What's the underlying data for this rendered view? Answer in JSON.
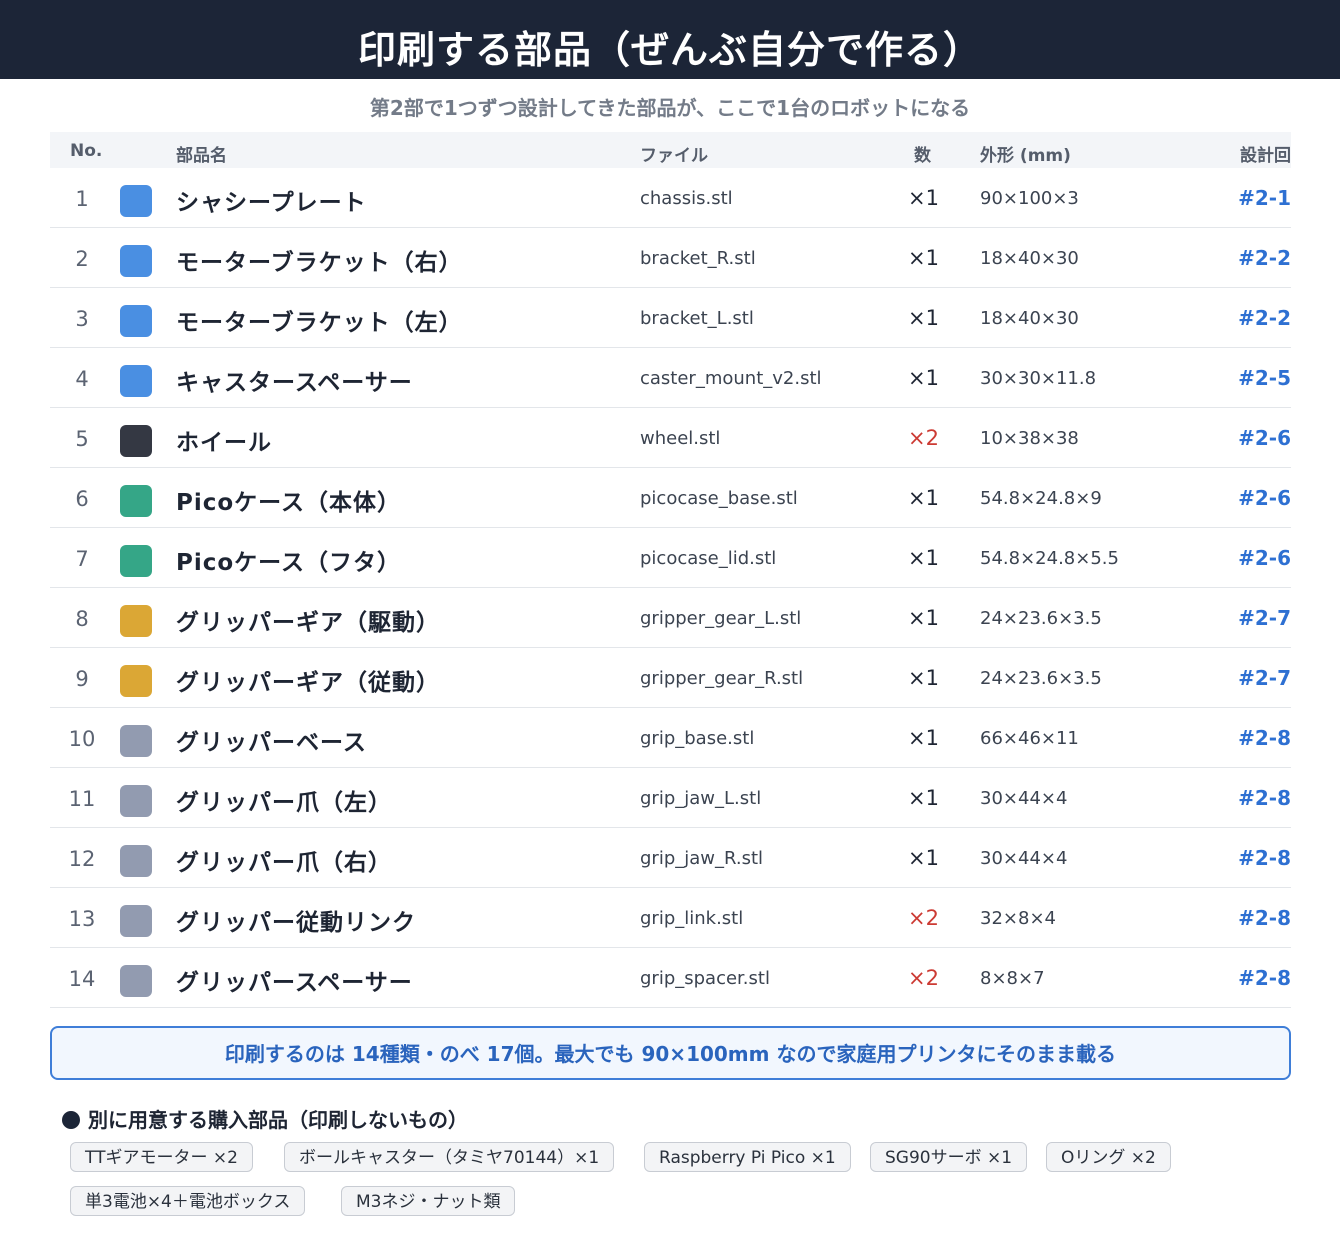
{
  "header": {
    "title": "印刷する部品（ぜんぶ自分で作る）",
    "subtitle": "第2部で1つずつ設計してきた部品が、ここで1台のロボットになる"
  },
  "table": {
    "columns": [
      "No.",
      "部品名",
      "ファイル",
      "数",
      "外形 (mm)",
      "設計回"
    ],
    "rows": [
      {
        "no": "1",
        "color": "#4a8fe2",
        "name": "シャシープレート",
        "file": "chassis.stl",
        "qty": "×1",
        "dims": "90×100×3",
        "ref": "#2-1"
      },
      {
        "no": "2",
        "color": "#4a8fe2",
        "name": "モーターブラケット（右）",
        "file": "bracket_R.stl",
        "qty": "×1",
        "dims": "18×40×30",
        "ref": "#2-2"
      },
      {
        "no": "3",
        "color": "#4a8fe2",
        "name": "モーターブラケット（左）",
        "file": "bracket_L.stl",
        "qty": "×1",
        "dims": "18×40×30",
        "ref": "#2-2"
      },
      {
        "no": "4",
        "color": "#4a8fe2",
        "name": "キャスタースペーサー",
        "file": "caster_mount_v2.stl",
        "qty": "×1",
        "dims": "30×30×11.8",
        "ref": "#2-5"
      },
      {
        "no": "5",
        "color": "#343843",
        "name": "ホイール",
        "file": "wheel.stl",
        "qty": "×2",
        "dims": "10×38×38",
        "ref": "#2-6"
      },
      {
        "no": "6",
        "color": "#35a687",
        "name": "Picoケース（本体）",
        "file": "picocase_base.stl",
        "qty": "×1",
        "dims": "54.8×24.8×9",
        "ref": "#2-6"
      },
      {
        "no": "7",
        "color": "#35a687",
        "name": "Picoケース（フタ）",
        "file": "picocase_lid.stl",
        "qty": "×1",
        "dims": "54.8×24.8×5.5",
        "ref": "#2-6"
      },
      {
        "no": "8",
        "color": "#dba735",
        "name": "グリッパーギア（駆動）",
        "file": "gripper_gear_L.stl",
        "qty": "×1",
        "dims": "24×23.6×3.5",
        "ref": "#2-7"
      },
      {
        "no": "9",
        "color": "#dba735",
        "name": "グリッパーギア（従動）",
        "file": "gripper_gear_R.stl",
        "qty": "×1",
        "dims": "24×23.6×3.5",
        "ref": "#2-7"
      },
      {
        "no": "10",
        "color": "#929bb0",
        "name": "グリッパーベース",
        "file": "grip_base.stl",
        "qty": "×1",
        "dims": "66×46×11",
        "ref": "#2-8"
      },
      {
        "no": "11",
        "color": "#929bb0",
        "name": "グリッパー爪（左）",
        "file": "grip_jaw_L.stl",
        "qty": "×1",
        "dims": "30×44×4",
        "ref": "#2-8"
      },
      {
        "no": "12",
        "color": "#929bb0",
        "name": "グリッパー爪（右）",
        "file": "grip_jaw_R.stl",
        "qty": "×1",
        "dims": "30×44×4",
        "ref": "#2-8"
      },
      {
        "no": "13",
        "color": "#929bb0",
        "name": "グリッパー従動リンク",
        "file": "grip_link.stl",
        "qty": "×2",
        "dims": "32×8×4",
        "ref": "#2-8"
      },
      {
        "no": "14",
        "color": "#929bb0",
        "name": "グリッパースペーサー",
        "file": "grip_spacer.stl",
        "qty": "×2",
        "dims": "8×8×7",
        "ref": "#2-8"
      }
    ]
  },
  "callout": "印刷するのは 14種類・のべ 17個。最大でも 90×100mm なので家庭用プリンタにそのまま載る",
  "purchased": {
    "heading": "別に用意する購入部品（印刷しないもの）",
    "items": [
      "TTギアモーター ×2",
      "ボールキャスター（タミヤ70144）×1",
      "Raspberry Pi Pico ×1",
      "SG90サーボ ×1",
      "Oリング ×2",
      "単3電池×4＋電池ボックス",
      "M3ネジ・ナット類"
    ]
  }
}
